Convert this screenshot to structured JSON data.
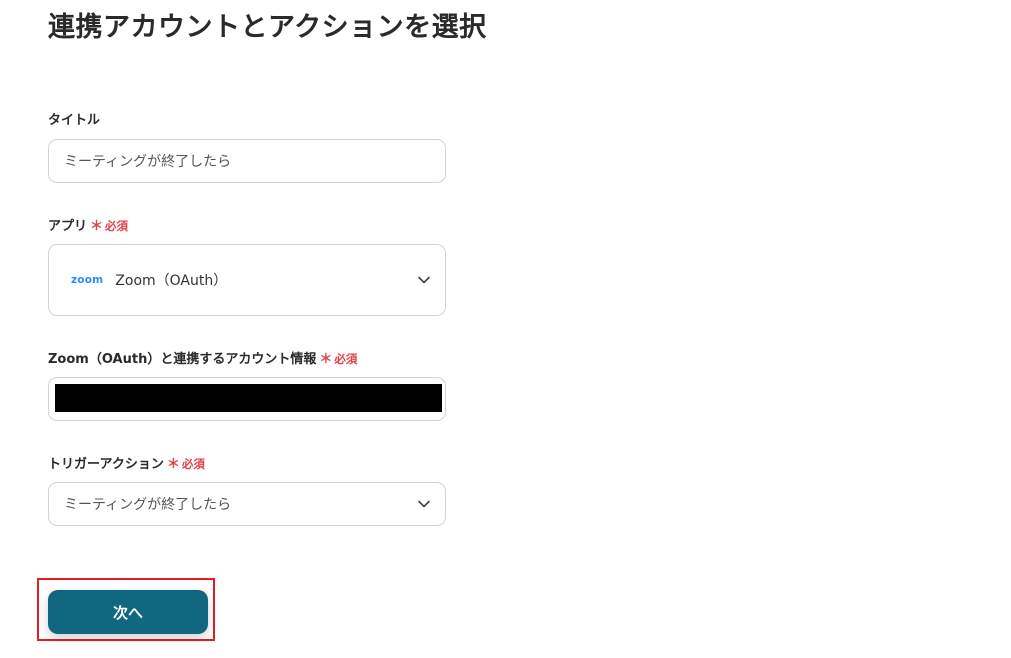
{
  "page": {
    "title": "連携アカウントとアクションを選択"
  },
  "form": {
    "title_field": {
      "label": "タイトル",
      "value": "ミーティングが終了したら"
    },
    "app_field": {
      "label": "アプリ",
      "required_mark": "＊",
      "required_text": "必須",
      "logo_text": "zoom",
      "value": "Zoom（OAuth）"
    },
    "account_field": {
      "label": "Zoom（OAuth）と連携するアカウント情報",
      "required_mark": "＊",
      "required_text": "必須"
    },
    "trigger_field": {
      "label": "トリガーアクション",
      "required_mark": "＊",
      "required_text": "必須",
      "value": "ミーティングが終了したら"
    }
  },
  "actions": {
    "next_label": "次へ"
  },
  "colors": {
    "primary_button": "#0f6780",
    "required": "#e0434b",
    "highlight_border": "#e31f26",
    "zoom_brand": "#2d8cff"
  },
  "icons": {
    "app_chevron": "chevron-down-icon",
    "trigger_chevron": "chevron-down-icon"
  }
}
